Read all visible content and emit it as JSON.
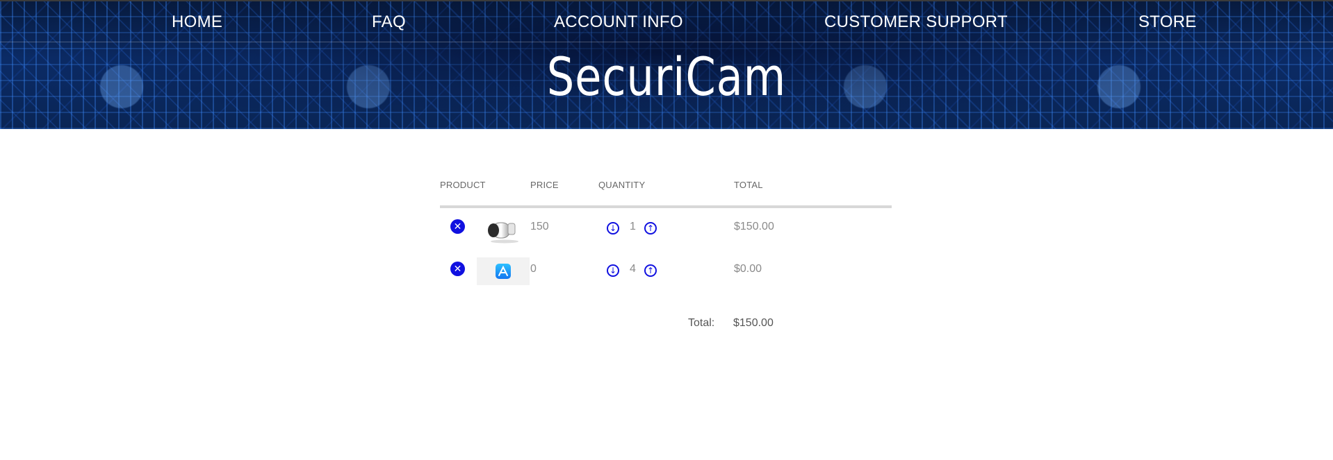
{
  "nav": {
    "home": "HOME",
    "faq": "FAQ",
    "account": "ACCOUNT INFO",
    "support": "CUSTOMER SUPPORT",
    "store": "STORE"
  },
  "brand": "SecuriCam",
  "cart": {
    "headers": {
      "product": "PRODUCT",
      "price": "PRICE",
      "quantity": "QUANTITY",
      "total": "TOTAL"
    },
    "rows": [
      {
        "image": "security-camera",
        "price": "150",
        "quantity": "1",
        "total": "$150.00"
      },
      {
        "image": "app-store-icon",
        "price": "0",
        "quantity": "4",
        "total": "$0.00"
      }
    ],
    "total_label": "Total:",
    "total_value": "$150.00"
  },
  "colors": {
    "accent": "#1010e0",
    "header_bg": "#0b2b66"
  }
}
